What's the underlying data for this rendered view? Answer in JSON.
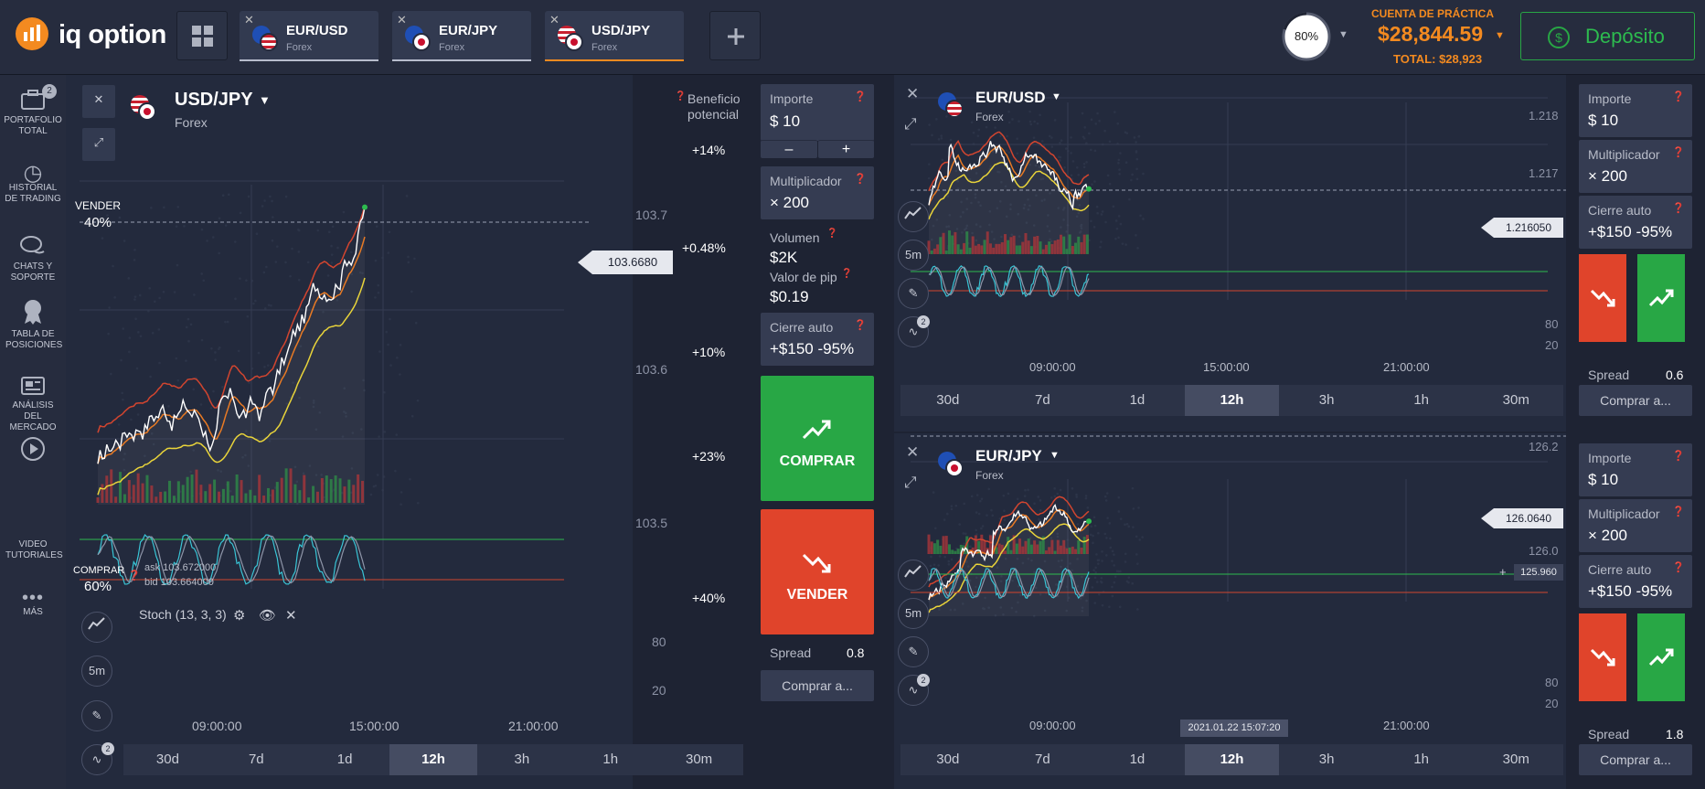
{
  "brand": {
    "name": "iq option"
  },
  "tabs": [
    {
      "pair": "EUR/USD",
      "type": "Forex"
    },
    {
      "pair": "EUR/JPY",
      "type": "Forex"
    },
    {
      "pair": "USD/JPY",
      "type": "Forex"
    }
  ],
  "header": {
    "progress": "80%",
    "progress_value": 0.8,
    "account_label": "CUENTA DE PRÁCTICA",
    "balance": "$28,844.59",
    "total": "TOTAL: $28,923",
    "deposit_label": "Depósito"
  },
  "sidebar": [
    {
      "label": "PORTAFOLIO TOTAL",
      "badge": "2",
      "icon": "briefcase-icon"
    },
    {
      "label": "HISTORIAL DE TRADING",
      "icon": "history-icon"
    },
    {
      "label": "CHATS Y SOPORTE",
      "icon": "chat-icon"
    },
    {
      "label": "TABLA DE POSICIONES",
      "icon": "medal-icon"
    },
    {
      "label": "ANÁLISIS DEL MERCADO",
      "icon": "newspaper-icon"
    },
    {
      "label": "VIDEO TUTORIALES",
      "icon": "play-icon"
    },
    {
      "label": "MÁS",
      "icon": "more-icon"
    }
  ],
  "main": {
    "pair": "USD/JPY",
    "type": "Forex",
    "sell_label": "VENDER",
    "sell_pct": "40%",
    "buy_label": "COMPRAR",
    "buy_pct": "60%",
    "profit_label": "Beneficio potencial",
    "profit_levels": [
      "+14%",
      "+0.48%",
      "+10%",
      "+23%",
      "+40%"
    ],
    "yticks": [
      "103.7",
      "103.6",
      "103.5"
    ],
    "price": "103.6680",
    "ask": "ask 103.672000",
    "bid": "bid 103.664000",
    "xticks": [
      "09:00:00",
      "15:00:00",
      "21:00:00"
    ],
    "indicator": "Stoch (13, 3, 3)",
    "osc_levels": [
      "80",
      "20"
    ],
    "indicator_badge": "2",
    "timeframes": [
      "30d",
      "7d",
      "1d",
      "12h",
      "3h",
      "1h",
      "30m"
    ],
    "active_tf": "12h",
    "trade": {
      "amount_label": "Importe",
      "amount": "$  10",
      "minus": "–",
      "plus": "+",
      "mult_label": "Multiplicador",
      "mult": "× 200",
      "volume_label": "Volumen",
      "volume": "$2K",
      "pip_label": "Valor de pip",
      "pip": "$0.19",
      "autoclose_label": "Cierre auto",
      "autoclose": "+$150 -95%",
      "buy": "COMPRAR",
      "sell": "VENDER",
      "spread_label": "Spread",
      "spread": "0.8",
      "buy_at": "Comprar a..."
    }
  },
  "eurusd": {
    "pair": "EUR/USD",
    "type": "Forex",
    "yticks": [
      "1.218",
      "1.217"
    ],
    "price": "1.216050",
    "xticks": [
      "09:00:00",
      "15:00:00",
      "21:00:00"
    ],
    "osc_levels": [
      "80",
      "20"
    ],
    "indicator_badge": "2",
    "timeframes": [
      "30d",
      "7d",
      "1d",
      "12h",
      "3h",
      "1h",
      "30m"
    ],
    "trade": {
      "amount_label": "Importe",
      "amount": "$  10",
      "mult_label": "Multiplicador",
      "mult": "× 200",
      "autoclose_label": "Cierre auto",
      "autoclose": "+$150 -95%",
      "spread_label": "Spread",
      "spread": "0.6",
      "buy_at": "Comprar a..."
    }
  },
  "eurjpy": {
    "pair": "EUR/JPY",
    "type": "Forex",
    "yticks": [
      "126.2",
      "126.0"
    ],
    "price": "126.0640",
    "hover_price": "125.960",
    "xticks": [
      "09:00:00",
      "15:00:00",
      "21:00:00"
    ],
    "osc_levels": [
      "80",
      "20"
    ],
    "indicator_badge": "2",
    "crosshair_time": "2021.01.22 15:07:20",
    "timeframes": [
      "30d",
      "7d",
      "1d",
      "12h",
      "3h",
      "1h",
      "30m"
    ],
    "trade": {
      "amount_label": "Importe",
      "amount": "$  10",
      "mult_label": "Multiplicador",
      "mult": "× 200",
      "autoclose_label": "Cierre auto",
      "autoclose": "+$150 -95%",
      "spread_label": "Spread",
      "spread": "1.8",
      "buy_at": "Comprar a..."
    }
  }
}
